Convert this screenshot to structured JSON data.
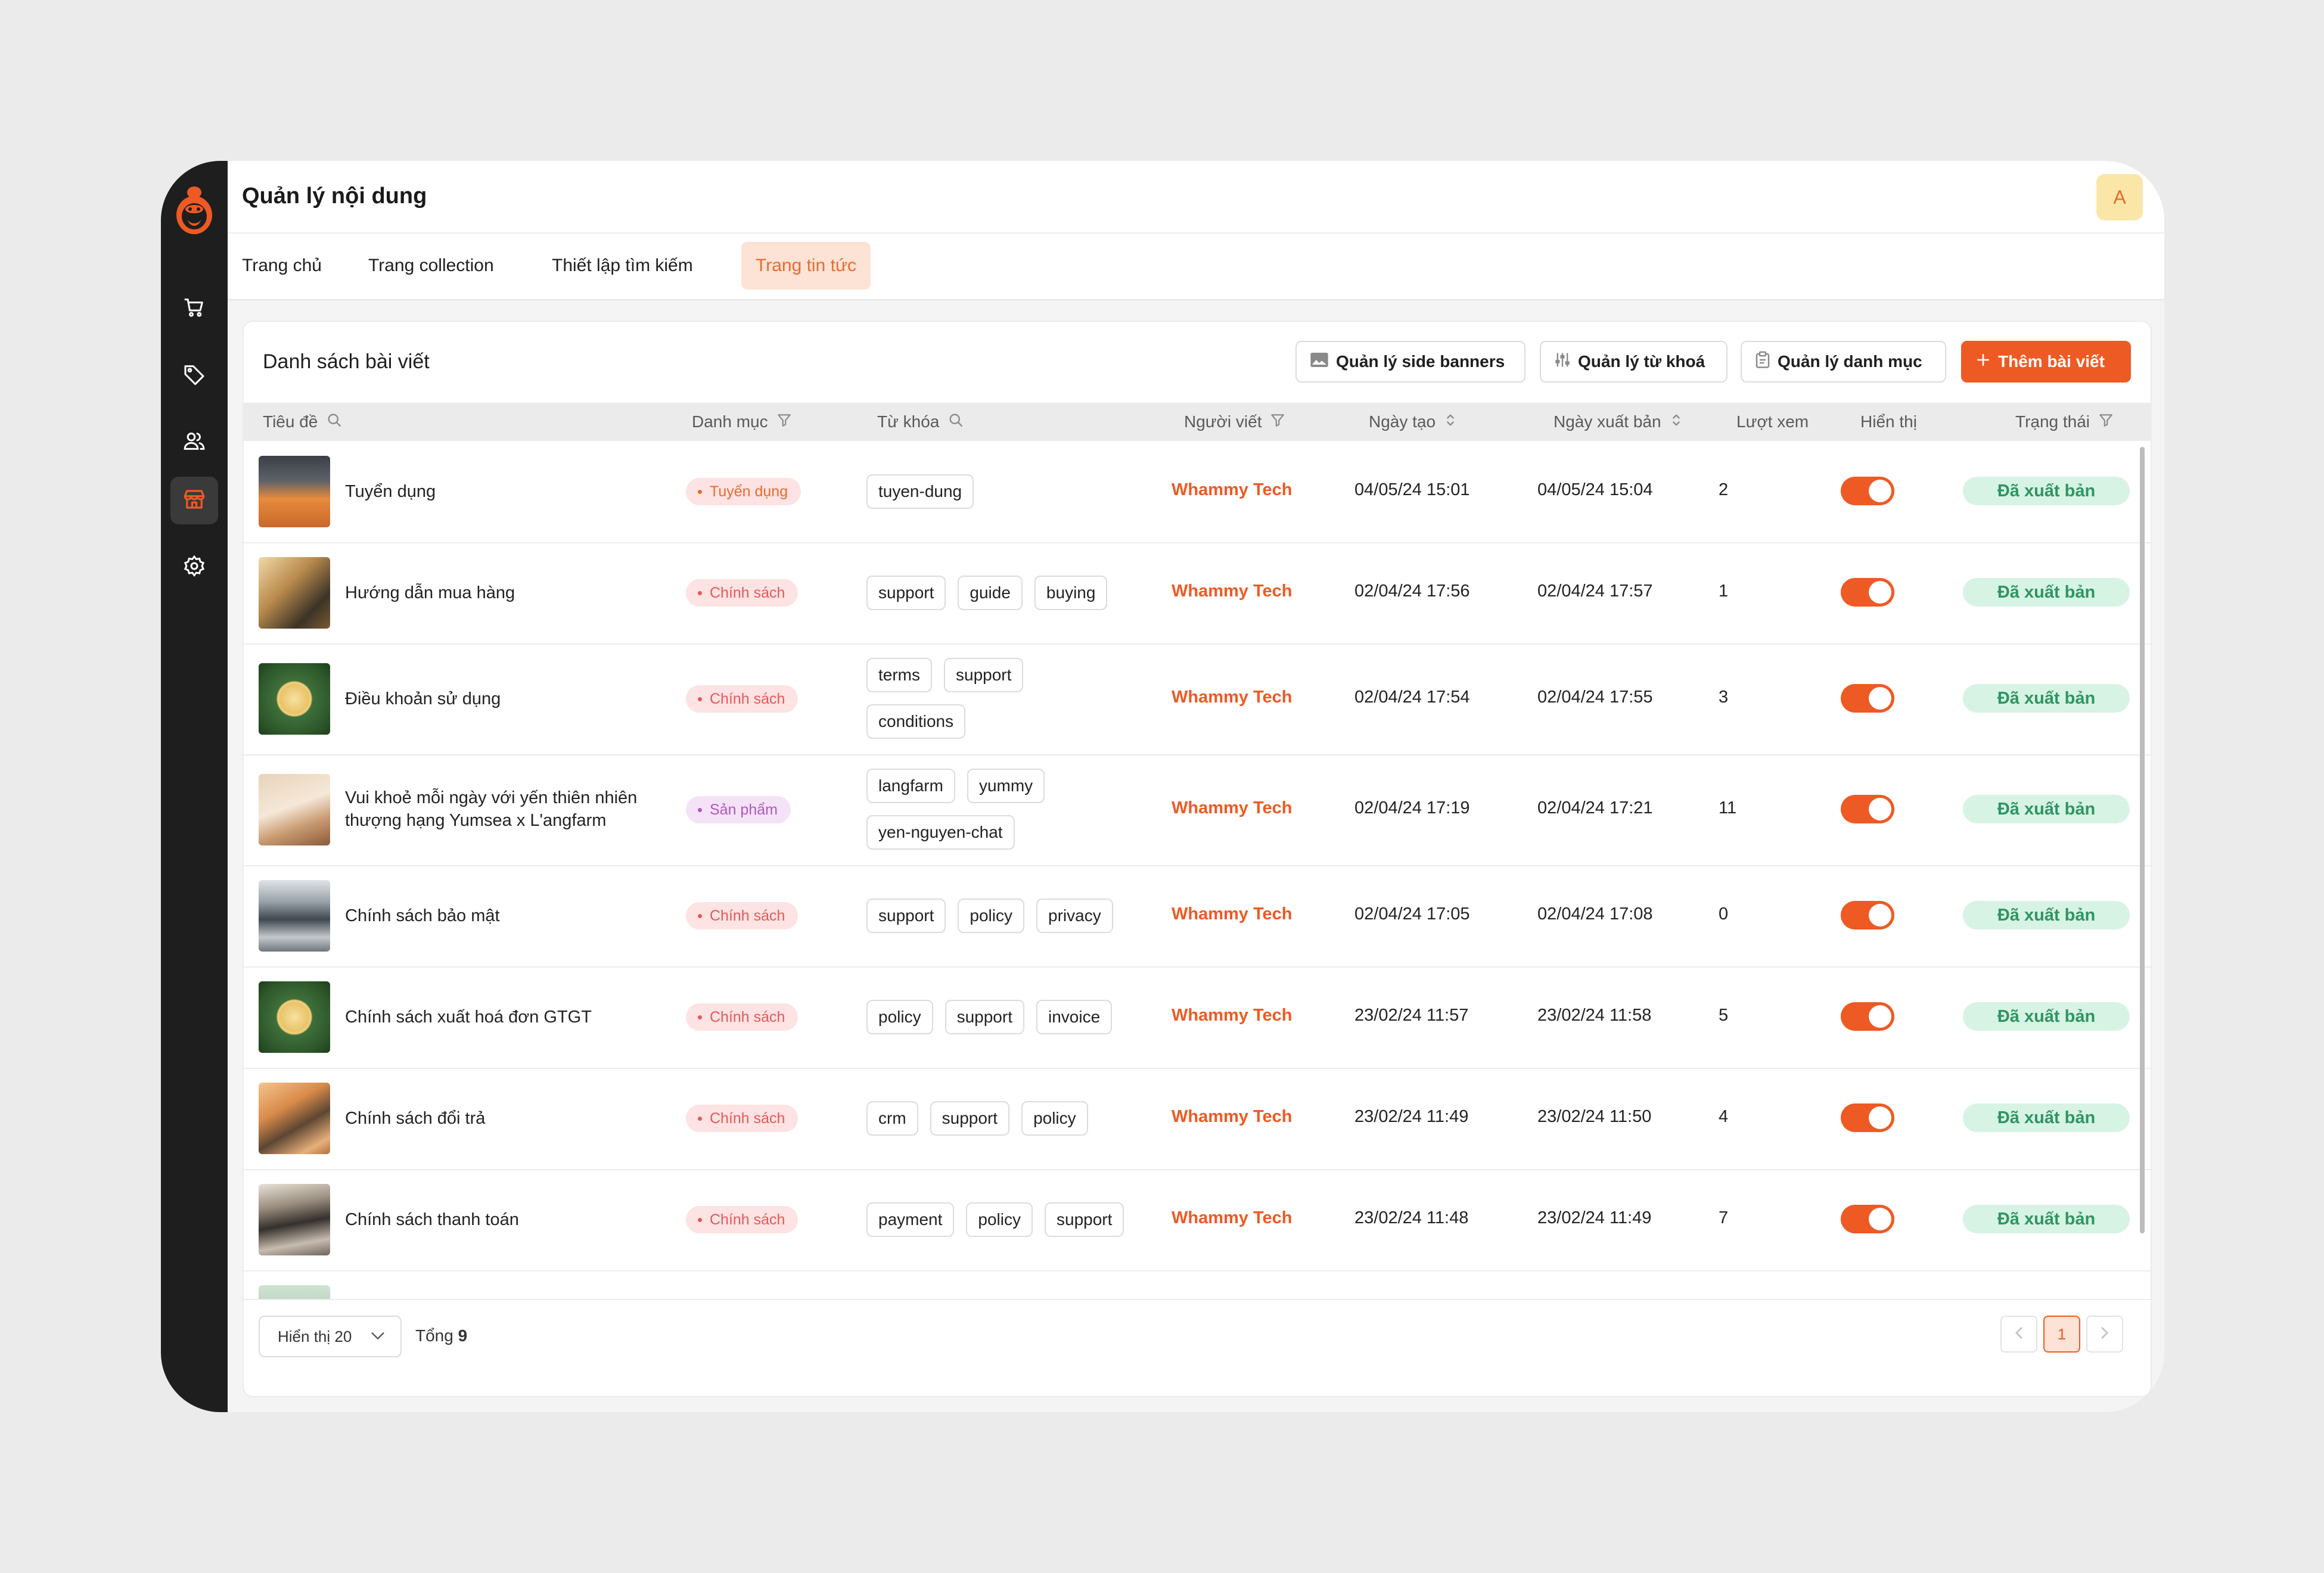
{
  "header": {
    "title": "Quản lý nội dung",
    "avatar_initial": "A"
  },
  "sidebar": {
    "items": [
      {
        "icon": "cart-icon"
      },
      {
        "icon": "tag-icon"
      },
      {
        "icon": "users-icon"
      },
      {
        "icon": "store-icon",
        "active": true
      },
      {
        "icon": "gear-icon"
      }
    ]
  },
  "tabs": [
    {
      "label": "Trang chủ"
    },
    {
      "label": "Trang collection"
    },
    {
      "label": "Thiết lập tìm kiếm"
    },
    {
      "label": "Trang tin tức",
      "active": true
    }
  ],
  "list": {
    "title": "Danh sách bài viết",
    "buttons": {
      "side_banners": "Quản lý side banners",
      "keywords": "Quản lý từ khoá",
      "categories": "Quản lý danh mục",
      "add_post": "Thêm bài viết"
    },
    "columns": {
      "title": "Tiêu đề",
      "category": "Danh mục",
      "keywords": "Từ khóa",
      "author": "Người viết",
      "created": "Ngày tạo",
      "published": "Ngày xuất bản",
      "views": "Lượt xem",
      "visible": "Hiển thị",
      "status": "Trạng thái"
    },
    "rows": [
      {
        "title": "Tuyển dụng",
        "category": "Tuyển dụng",
        "tags": [
          "tuyen-dung"
        ],
        "author": "Whammy Tech",
        "created": "04/05/24 15:01",
        "published": "04/05/24 15:04",
        "views": "2",
        "visible": true,
        "status": "Đã xuất bản"
      },
      {
        "title": "Hướng dẫn mua hàng",
        "category": "Chính sách",
        "tags": [
          "support",
          "guide",
          "buying"
        ],
        "author": "Whammy Tech",
        "created": "02/04/24 17:56",
        "published": "02/04/24 17:57",
        "views": "1",
        "visible": true,
        "status": "Đã xuất bản"
      },
      {
        "title": "Điều khoản sử dụng",
        "category": "Chính sách",
        "tags": [
          "terms",
          "support",
          "conditions"
        ],
        "author": "Whammy Tech",
        "created": "02/04/24 17:54",
        "published": "02/04/24 17:55",
        "views": "3",
        "visible": true,
        "status": "Đã xuất bản"
      },
      {
        "title": "Vui khoẻ mỗi ngày với yến thiên nhiên thượng hạng Yumsea x L'angfarm",
        "category": "Sản phẩm",
        "tags": [
          "langfarm",
          "yummy",
          "yen-nguyen-chat"
        ],
        "author": "Whammy Tech",
        "created": "02/04/24 17:19",
        "published": "02/04/24 17:21",
        "views": "11",
        "visible": true,
        "status": "Đã xuất bản"
      },
      {
        "title": "Chính sách bảo mật",
        "category": "Chính sách",
        "tags": [
          "support",
          "policy",
          "privacy"
        ],
        "author": "Whammy Tech",
        "created": "02/04/24 17:05",
        "published": "02/04/24 17:08",
        "views": "0",
        "visible": true,
        "status": "Đã xuất bản"
      },
      {
        "title": "Chính sách xuất hoá đơn GTGT",
        "category": "Chính sách",
        "tags": [
          "policy",
          "support",
          "invoice"
        ],
        "author": "Whammy Tech",
        "created": "23/02/24 11:57",
        "published": "23/02/24 11:58",
        "views": "5",
        "visible": true,
        "status": "Đã xuất bản"
      },
      {
        "title": "Chính sách đổi trả",
        "category": "Chính sách",
        "tags": [
          "crm",
          "support",
          "policy"
        ],
        "author": "Whammy Tech",
        "created": "23/02/24 11:49",
        "published": "23/02/24 11:50",
        "views": "4",
        "visible": true,
        "status": "Đã xuất bản"
      },
      {
        "title": "Chính sách thanh toán",
        "category": "Chính sách",
        "tags": [
          "payment",
          "policy",
          "support"
        ],
        "author": "Whammy Tech",
        "created": "23/02/24 11:48",
        "published": "23/02/24 11:49",
        "views": "7",
        "visible": true,
        "status": "Đã xuất bản"
      }
    ]
  },
  "pagination": {
    "page_size_label": "Hiển thị 20",
    "total_label": "Tổng",
    "total": "9",
    "current_page": "1"
  },
  "colors": {
    "accent": "#ee5a24",
    "status_bg": "#d7f3e4",
    "status_text": "#2f9563",
    "sidebar": "#1e1e1e"
  }
}
